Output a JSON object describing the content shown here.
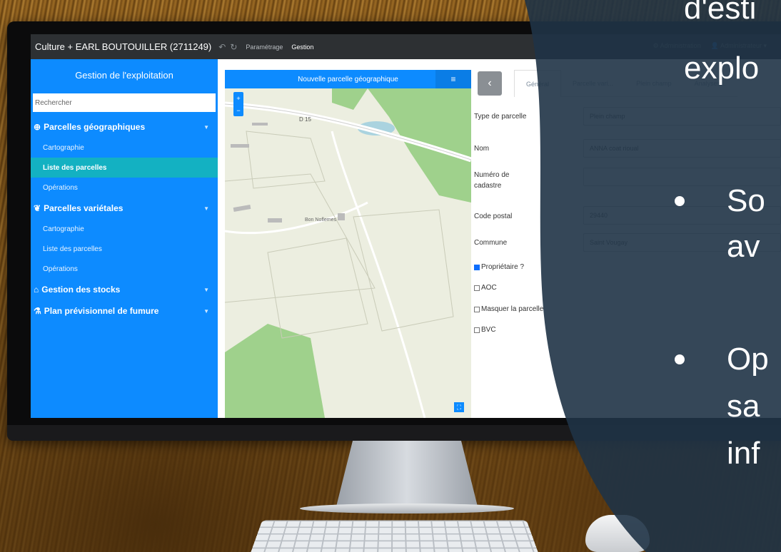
{
  "app": {
    "title": "Culture + EARL BOUTOUILLER (2711249)",
    "nav": [
      "Paramétrage",
      "Gestion"
    ],
    "right_menu": [
      "Administration",
      "Administrateur"
    ]
  },
  "sidebar": {
    "header": "Gestion de l'exploitation",
    "search_placeholder": "Rechercher",
    "groups": [
      {
        "label": "Parcelles géographiques",
        "icon": "globe-icon",
        "items": [
          "Cartographie",
          "Liste des parcelles",
          "Opérations"
        ],
        "active": "Liste des parcelles"
      },
      {
        "label": "Parcelles variétales",
        "icon": "leaf-icon",
        "items": [
          "Cartographie",
          "Liste des parcelles",
          "Opérations"
        ]
      },
      {
        "label": "Gestion des stocks",
        "icon": "warehouse-icon",
        "items": []
      },
      {
        "label": "Plan prévisionnel de fumure",
        "icon": "flask-icon",
        "items": []
      }
    ]
  },
  "map": {
    "title": "Nouvelle parcelle géographique",
    "road_label": "D 15",
    "place_label": "Bon Noflemes"
  },
  "form": {
    "tabs": [
      "Général",
      "Parcelle vari...",
      "Plein champ",
      "Analyses..."
    ],
    "fields": [
      {
        "label": "Type de parcelle",
        "value": "Plein champ"
      },
      {
        "label": "Nom",
        "value": "ANNA coat rioual"
      },
      {
        "label": "Numéro de cadastre",
        "value": ""
      },
      {
        "label": "Code postal",
        "value": "29440"
      },
      {
        "label": "Commune",
        "value": "Saint Vougay"
      }
    ],
    "checkboxes": [
      {
        "label": "Propriétaire ?",
        "checked": true
      },
      {
        "label": "AOC",
        "checked": false
      },
      {
        "label": "Masquer la parcelle",
        "checked": false
      },
      {
        "label": "BVC",
        "checked": false
      }
    ]
  },
  "slide": {
    "line1": "d'esti",
    "line2": "explo",
    "bullet1_a": "So",
    "bullet1_b": "av",
    "bullet2_a": "Op",
    "bullet2_b": "sa",
    "bullet2_c": "inf"
  },
  "colors": {
    "sidebar": "#0d8bff",
    "sidebar_active": "#13b1c2",
    "topbar": "#2d3033",
    "overlay": "#1f3346"
  }
}
